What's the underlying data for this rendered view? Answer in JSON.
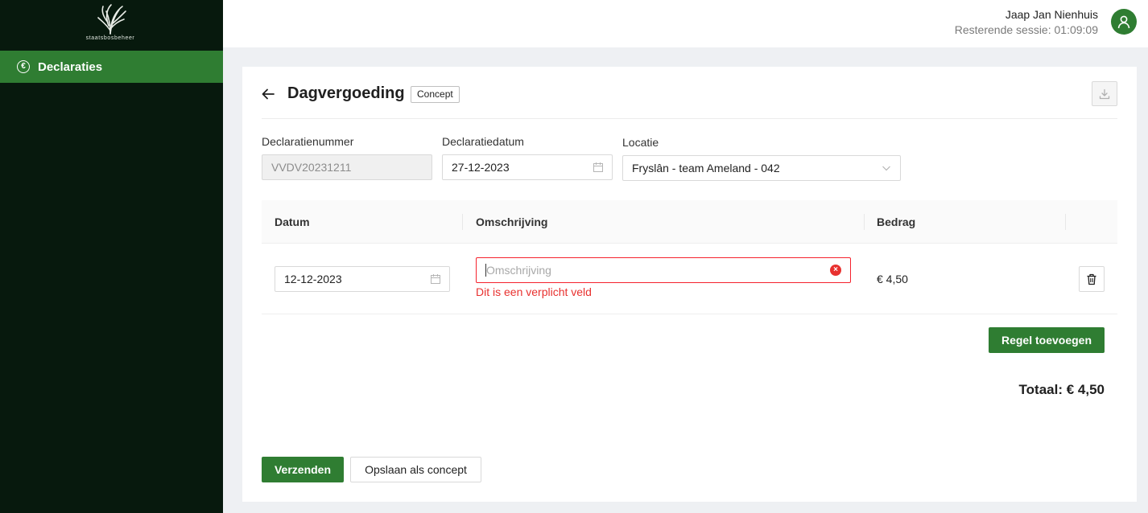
{
  "sidebar": {
    "logo_text": "staatsbosbeheer",
    "nav": [
      {
        "label": "Declaraties",
        "icon": "euro-circle-icon"
      }
    ]
  },
  "header": {
    "user_name": "Jaap Jan Nienhuis",
    "session": "Resterende sessie: 01:09:09"
  },
  "page": {
    "title": "Dagvergoeding",
    "status_badge": "Concept"
  },
  "form": {
    "number_label": "Declaratienummer",
    "number_value": "VVDV20231211",
    "date_label": "Declaratiedatum",
    "date_value": "27-12-2023",
    "location_label": "Locatie",
    "location_value": "Fryslân - team Ameland - 042"
  },
  "table": {
    "columns": [
      "Datum",
      "Omschrijving",
      "Bedrag"
    ],
    "rows": [
      {
        "date": "12-12-2023",
        "description_placeholder": "Omschrijving",
        "error": "Dit is een verplicht veld",
        "amount": "€ 4,50"
      }
    ]
  },
  "actions": {
    "add_row": "Regel toevoegen",
    "total": "Totaal: € 4,50",
    "submit": "Verzenden",
    "save_draft": "Opslaan als concept"
  },
  "colors": {
    "sidebar_bg": "#07190d",
    "brand_green": "#2f7d32",
    "error_red": "#e8312f"
  }
}
